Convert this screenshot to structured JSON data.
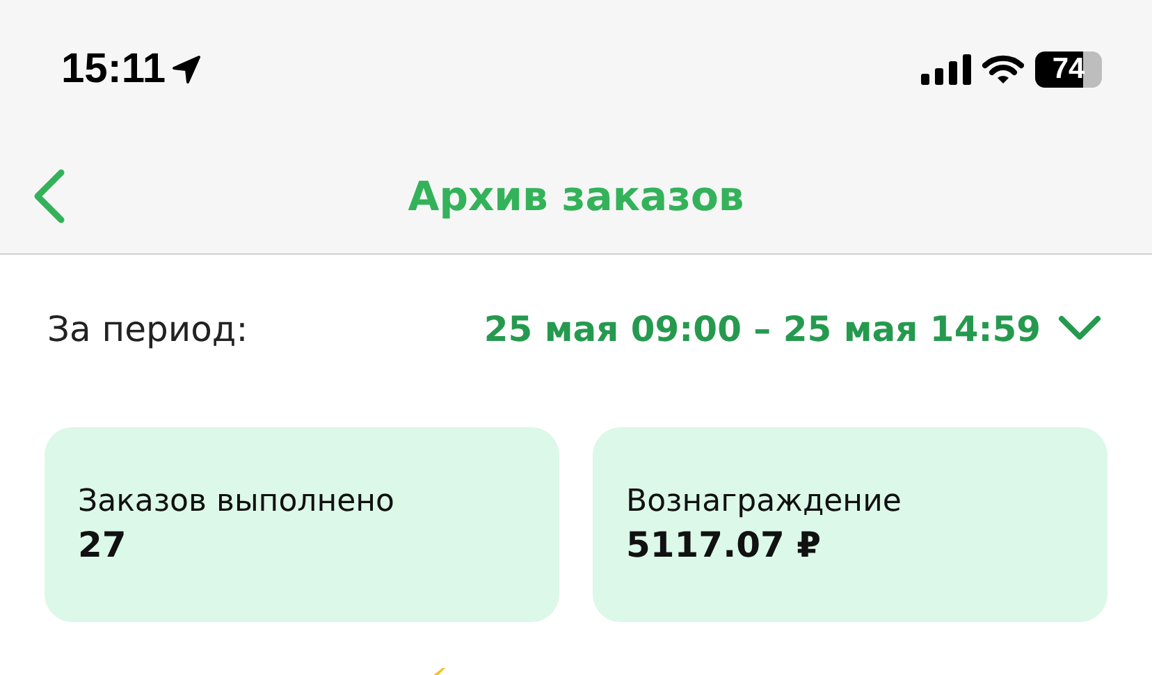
{
  "status_bar": {
    "time": "15:11",
    "battery": "74"
  },
  "nav": {
    "title": "Архив заказов"
  },
  "period": {
    "label": "За период:",
    "value": "25 мая 09:00 – 25 мая 14:59"
  },
  "cards": [
    {
      "label": "Заказов выполнено",
      "value": "27"
    },
    {
      "label": "Вознаграждение",
      "value": "5117.07 ₽"
    }
  ]
}
